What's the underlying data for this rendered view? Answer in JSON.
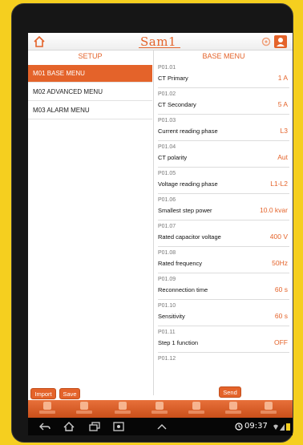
{
  "header": {
    "brand": "Sam1",
    "setup_title": "SETUP",
    "base_menu_title": "BASE MENU"
  },
  "menu": [
    {
      "label": "M01 BASE MENU",
      "active": true
    },
    {
      "label": "M02 ADVANCED MENU",
      "active": false
    },
    {
      "label": "M03 ALARM MENU",
      "active": false
    }
  ],
  "params": [
    {
      "code": "P01.01",
      "name": "CT Primary",
      "value": "1 A"
    },
    {
      "code": "P01.02",
      "name": "CT Secondary",
      "value": "5 A"
    },
    {
      "code": "P01.03",
      "name": "Current reading phase",
      "value": "L3"
    },
    {
      "code": "P01.04",
      "name": "CT polarity",
      "value": "Aut"
    },
    {
      "code": "P01.05",
      "name": "Voltage reading phase",
      "value": "L1-L2"
    },
    {
      "code": "P01.06",
      "name": "Smallest step power",
      "value": "10.0 kvar"
    },
    {
      "code": "P01.07",
      "name": "Rated capacitor voltage",
      "value": "400 V"
    },
    {
      "code": "P01.08",
      "name": "Rated frequency",
      "value": "50Hz"
    },
    {
      "code": "P01.09",
      "name": "Reconnection time",
      "value": "60 s"
    },
    {
      "code": "P01.10",
      "name": "Sensitivity",
      "value": "60 s"
    },
    {
      "code": "P01.11",
      "name": "Step 1 function",
      "value": "OFF"
    },
    {
      "code": "P01.12",
      "name": "",
      "value": ""
    }
  ],
  "buttons": {
    "import": "Import",
    "save": "Save",
    "send": "Send"
  },
  "status": {
    "time": "09:37"
  },
  "colors": {
    "accent": "#e4632a",
    "background": "#f5cf1f"
  },
  "icons": {
    "nav": [
      "home-icon",
      "settings-icon",
      "measures-icon",
      "alarms-icon",
      "history-icon",
      "info-icon",
      "help-icon"
    ],
    "system": [
      "back-icon",
      "home-icon",
      "recent-apps-icon",
      "screenshot-icon",
      "up-chevron-icon"
    ]
  }
}
